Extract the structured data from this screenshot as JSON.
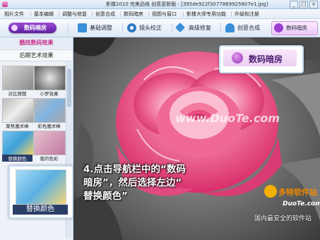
{
  "window": {
    "title": "影楼2010 完美品格 创意更新版 - [395de922f3077869925807e1.jpg]",
    "controls": [
      "_",
      "□",
      "×"
    ]
  },
  "menu": {
    "items": [
      "相片文件",
      "基本编辑",
      "调整与修复",
      "创意合成",
      "数码暗房",
      "视图与窗口",
      "影楼大师专用功能",
      "升级和注册"
    ]
  },
  "toolbar": {
    "darkroom_label": "数码暗房",
    "tools": [
      {
        "label": "基础调整",
        "icon": "sliders-icon",
        "color": "#3a8fd8"
      },
      {
        "label": "镜头校正",
        "icon": "lens-icon",
        "color": "#2f7ac4"
      },
      {
        "label": "高级修复",
        "icon": "wand-icon",
        "color": "#3a8fd8"
      },
      {
        "label": "创意合成",
        "icon": "person-icon",
        "color": "#3a8fd8"
      },
      {
        "label": "数码暗房",
        "icon": "bulb-icon",
        "color": "#9b3fd1"
      }
    ]
  },
  "left_panel": {
    "title": "酷炫数码效果",
    "subtitle": "后期艺术效果",
    "thumbnails": [
      {
        "label": "对比原图"
      },
      {
        "label": "小罗效果"
      },
      {
        "label": "聚焦魔术棒"
      },
      {
        "label": "彩色魔术棒"
      },
      {
        "label": "替换颜色"
      },
      {
        "label": "我的色彩"
      }
    ]
  },
  "callouts": {
    "top_label": "数码暗房",
    "left_label": "替换颜色"
  },
  "instruction": {
    "line1": "4.点击导航栏中的“数码",
    "line2": "暗房”，然后选择左边“",
    "line3": "替换颜色”"
  },
  "watermark": {
    "mid": "www.DuoTe.com",
    "brand": "多特软件站",
    "domain": "DuoTe.com",
    "slogan": "国内最安全的软件站"
  },
  "colors": {
    "accent_purple": "#7b2fc0",
    "brand_pink": "#c62f8a",
    "rose_pink": "#e8457f",
    "selected_caption_bg": "#2b3e66"
  }
}
